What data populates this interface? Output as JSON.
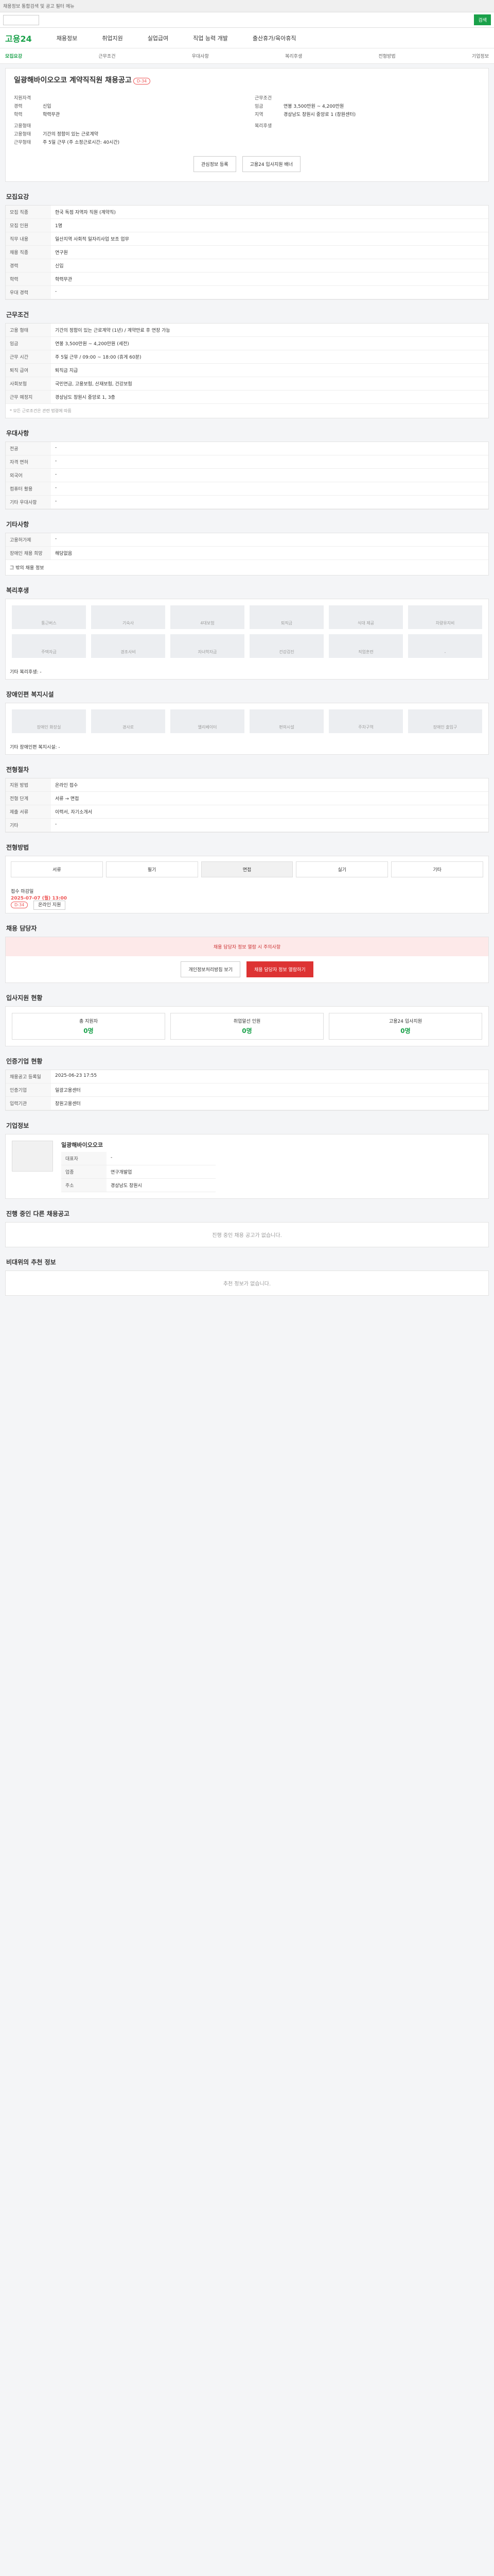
{
  "topbar": "채용정보 통합검색 및 공고 필터 메뉴",
  "search": {
    "select": "",
    "btn": "검색",
    "placeholder": ""
  },
  "logo": "고용24",
  "gnb": [
    "채용정보",
    "취업지원",
    "실업급여",
    "직업 능력 개발",
    "출산휴가/육아휴직"
  ],
  "subnav": [
    "모집요강",
    "근무조건",
    "우대사항",
    "복리후생",
    "전형방법",
    "기업정보"
  ],
  "job": {
    "title": "일광해바이오오코 계약직직원 채용공고",
    "dday": "D-34"
  },
  "overview": {
    "left": [
      [
        "지원자격",
        ""
      ],
      [
        "경력",
        "신입"
      ],
      [
        "학력",
        "학력무관"
      ],
      [
        "고용형태",
        ""
      ],
      [
        "고용형태",
        "기간의 정함이 있는 근로계약"
      ],
      [
        "근무형태",
        "주 5일 근무 (주 소정근로시간: 40시간)"
      ]
    ],
    "right": [
      [
        "근무조건",
        ""
      ],
      [
        "임금",
        "연봉 3,500만원 ~ 4,200만원"
      ],
      [
        "지역",
        "경상남도 창원시 중앙로 1 (창원센터)"
      ],
      [
        "복리후생",
        ""
      ]
    ]
  },
  "buttons": [
    "관심정보 등록",
    "고용24 입사지원 배너"
  ],
  "sec": {
    "recruit": "모집요강",
    "work": "근무조건",
    "pref": "우대사항",
    "etc": "기타사항",
    "wel": "복리후생",
    "disab": "장애인편 복지시설",
    "fee": "전형절차",
    "proc": "전형방법",
    "mgr": "채용 담당자",
    "stats": "입사지원 현황",
    "info": "인증기업 현황",
    "corp": "기업정보",
    "rel": "진행 중인 다른 채용공고",
    "nearby": "비대위의 추천 정보"
  },
  "recruit": [
    [
      "모집 직종",
      "한국 독점 자역자 직원 (계약직)"
    ],
    [
      "모집 인원",
      "1명"
    ],
    [
      "직무 내용",
      "일산지역 사회적 일자리사업 보조 업무"
    ],
    [
      "채용 직종",
      "연구원"
    ],
    [
      "경력",
      "신입"
    ],
    [
      "학력",
      "학력무관"
    ],
    [
      "우대 경력",
      "-"
    ]
  ],
  "work": [
    [
      "고용 형태",
      "기간의 정함이 있는 근로계약 (1년) / 계약만료 후 연장 가능"
    ],
    [
      "임금",
      "연봉 3,500만원 ~ 4,200만원 (세전)"
    ],
    [
      "근무 시간",
      "주 5일 근무 / 09:00 ~ 18:00 (휴게 60분)"
    ],
    [
      "퇴직 급여",
      "퇴직금 지급"
    ],
    [
      "사회보험",
      "국민연금, 고용보험, 산재보험, 건강보험"
    ],
    [
      "근무 예정지",
      "경상남도 창원시 중앙로 1, 3층"
    ]
  ],
  "workNote": "* 모든 근로조건은 관련 법령에 따름",
  "pref": [
    [
      "전공",
      "-"
    ],
    [
      "자격 면허",
      "-"
    ],
    [
      "외국어",
      "-"
    ],
    [
      "컴퓨터 활용",
      "-"
    ],
    [
      "기타 우대사항",
      "-"
    ]
  ],
  "etc": [
    [
      "고용허가제",
      "-"
    ],
    [
      "장애인 채용 희망",
      "해당없음"
    ]
  ],
  "etcNote": "그 밖의 채용 정보",
  "wel": [
    "통근버스",
    "기숙사",
    "4대보험",
    "퇴직금",
    "식대 제공",
    "차량유지비",
    "주택자금",
    "경조사비",
    "자녀학자금",
    "건강검진",
    "직업훈련",
    "-"
  ],
  "welNote": "기타 복리후생: -",
  "disab": [
    "장애인 화장실",
    "경사로",
    "엘리베이터",
    "편의시설",
    "주차구역",
    "장애인 출입구"
  ],
  "disabNote": "기타 장애인편 복지시설: -",
  "fee": [
    [
      "지원 방법",
      "온라인 접수"
    ],
    [
      "전형 단계",
      "서류 → 면접"
    ],
    [
      "제출 서류",
      "이력서, 자기소개서"
    ],
    [
      "기타",
      "-"
    ]
  ],
  "proc": [
    "서류",
    "필기",
    "면접",
    "실기",
    "기타"
  ],
  "deadline": {
    "label": "접수 마감일",
    "date": "2025-07-07 (월) 13:00",
    "dday": "D-34",
    "tag": "온라인 지원"
  },
  "mgrAlert": "채용 담당자 정보 열람 시 주의사항",
  "mgrBtns": [
    "개인정보처리방침 보기",
    "채용 담당자 정보 열람하기"
  ],
  "stats": [
    [
      "총 지원자",
      "0명"
    ],
    [
      "취업알선 인원",
      "0명"
    ],
    [
      "고용24 입사지원",
      "0명"
    ]
  ],
  "info": [
    [
      "채용공고 등록일",
      "2025-06-23 17:55"
    ],
    [
      "인증기업",
      "일광고용센터"
    ],
    [
      "입력기관",
      "창원고용센터"
    ]
  ],
  "corp": {
    "name": "일광해바이오오코",
    "rows": [
      [
        "대표자",
        "-"
      ],
      [
        "업종",
        "연구개발업"
      ],
      [
        "주소",
        "경상남도 창원시"
      ]
    ]
  },
  "relNote": "진행 중인 채용 공고가 없습니다.",
  "nearNote": "추천 정보가 없습니다."
}
